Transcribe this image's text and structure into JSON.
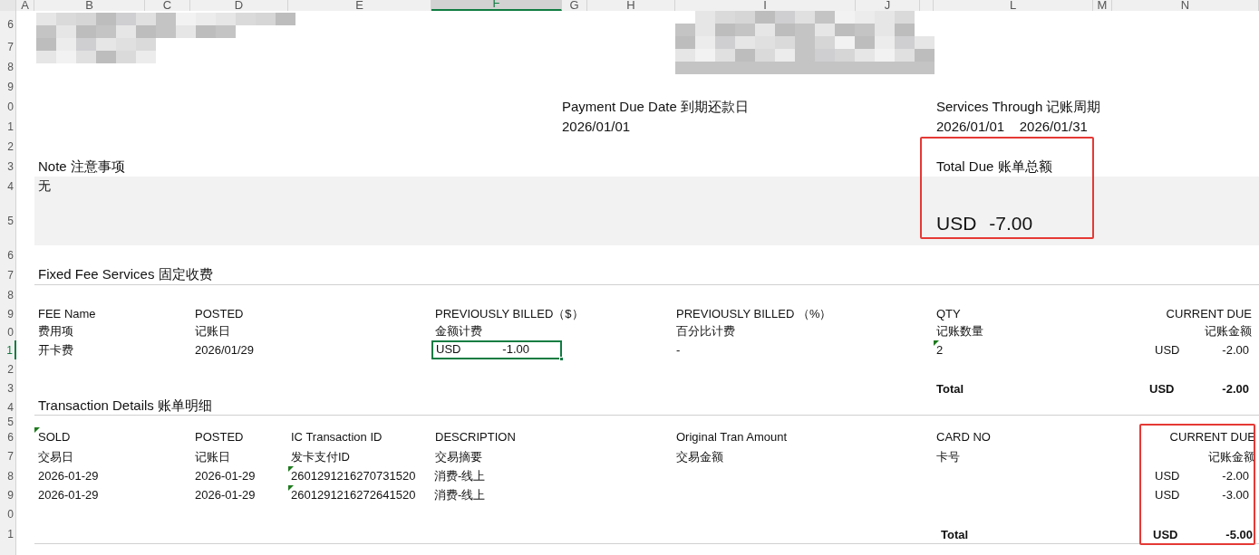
{
  "columns": [
    {
      "label": "A",
      "selected": false
    },
    {
      "label": "B",
      "selected": false
    },
    {
      "label": "C",
      "selected": false
    },
    {
      "label": "D",
      "selected": false
    },
    {
      "label": "E",
      "selected": false
    },
    {
      "label": "F",
      "selected": true
    },
    {
      "label": "G",
      "selected": false
    },
    {
      "label": "H",
      "selected": false
    },
    {
      "label": "I",
      "selected": false
    },
    {
      "label": "J",
      "selected": false
    },
    {
      "label": "L",
      "selected": false
    },
    {
      "label": "M",
      "selected": false
    },
    {
      "label": "N",
      "selected": false
    }
  ],
  "rows": [
    {
      "label": "6",
      "selected": false
    },
    {
      "label": "7",
      "selected": false
    },
    {
      "label": "8",
      "selected": false
    },
    {
      "label": "9",
      "selected": false
    },
    {
      "label": "0",
      "selected": false
    },
    {
      "label": "1",
      "selected": false
    },
    {
      "label": "2",
      "selected": false
    },
    {
      "label": "3",
      "selected": false
    },
    {
      "label": "4",
      "selected": false
    },
    {
      "label": "5",
      "selected": false
    },
    {
      "label": "6",
      "selected": false
    },
    {
      "label": "7",
      "selected": false
    },
    {
      "label": "8",
      "selected": false
    },
    {
      "label": "9",
      "selected": false
    },
    {
      "label": "0",
      "selected": false
    },
    {
      "label": "1",
      "selected": true
    },
    {
      "label": "2",
      "selected": false
    },
    {
      "label": "3",
      "selected": false
    },
    {
      "label": "4",
      "selected": false
    },
    {
      "label": "5",
      "selected": false
    },
    {
      "label": "6",
      "selected": false
    },
    {
      "label": "7",
      "selected": false
    },
    {
      "label": "8",
      "selected": false
    },
    {
      "label": "9",
      "selected": false
    },
    {
      "label": "0",
      "selected": false
    },
    {
      "label": "1",
      "selected": false
    }
  ],
  "payment_due": {
    "label": "Payment Due Date 到期还款日",
    "value": "2026/01/01"
  },
  "services_through": {
    "label": "Services Through 记账周期",
    "value": "2026/01/01    2026/01/31"
  },
  "note": {
    "label": "Note 注意事项",
    "value": "无"
  },
  "total_due": {
    "label": "Total Due 账单总额",
    "currency": "USD",
    "amount": "-7.00"
  },
  "fixed_fee": {
    "title": "Fixed Fee Services 固定收费",
    "columns": [
      {
        "en": "FEE Name",
        "zh": "费用项"
      },
      {
        "en": "POSTED",
        "zh": "记账日"
      },
      {
        "en": "PREVIOUSLY BILLED（$）",
        "zh": "金额计费"
      },
      {
        "en": "PREVIOUSLY BILLED （%）",
        "zh": "百分比计费"
      },
      {
        "en": "QTY",
        "zh": "记账数量"
      },
      {
        "en": "CURRENT DUE",
        "zh": "记账金额"
      }
    ],
    "rows": [
      {
        "fee_name": "开卡费",
        "posted": "2026/01/29",
        "billed_amount": {
          "currency": "USD",
          "amount": "-1.00",
          "selected": true
        },
        "billed_percent": "-",
        "qty": "2",
        "qty_flagged": true,
        "current_due": {
          "currency": "USD",
          "amount": "-2.00"
        }
      }
    ],
    "total": {
      "label": "Total",
      "currency": "USD",
      "amount": "-2.00"
    }
  },
  "transactions": {
    "title": "Transaction Details 账单明细",
    "columns": [
      {
        "en": "SOLD",
        "zh": "交易日",
        "flagged": true
      },
      {
        "en": "POSTED",
        "zh": "记账日",
        "flagged": false
      },
      {
        "en": "IC Transaction ID",
        "zh": "发卡支付ID",
        "flagged": false
      },
      {
        "en": "DESCRIPTION",
        "zh": "交易摘要",
        "flagged": false
      },
      {
        "en": "Original Tran  Amount",
        "zh": "交易金额",
        "flagged": false
      },
      {
        "en": "CARD NO",
        "zh": "卡号",
        "flagged": false
      },
      {
        "en": "CURRENT DUE",
        "zh": "记账金额",
        "flagged": false
      }
    ],
    "rows": [
      {
        "sold": "2026-01-29",
        "posted": "2026-01-29",
        "ic_id": "2601291216270731520",
        "ic_id_flagged": true,
        "description": "消费-线上",
        "current_due": {
          "currency": "USD",
          "amount": "-2.00"
        }
      },
      {
        "sold": "2026-01-29",
        "posted": "2026-01-29",
        "ic_id": "2601291216272641520",
        "ic_id_flagged": true,
        "description": "消费-线上",
        "current_due": {
          "currency": "USD",
          "amount": "-3.00"
        }
      }
    ],
    "total": {
      "label": "Total",
      "currency": "USD",
      "amount": "-5.00"
    }
  }
}
